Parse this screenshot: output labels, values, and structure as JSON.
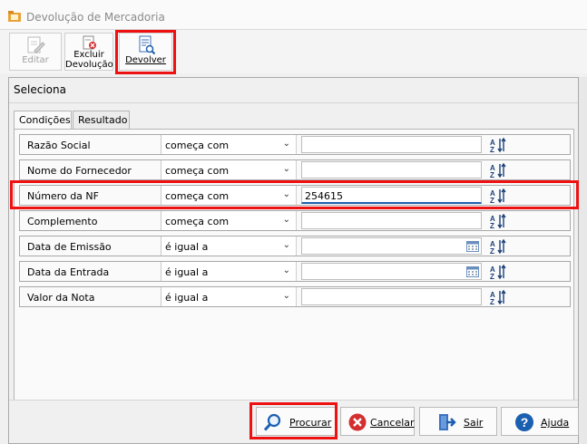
{
  "window": {
    "title": "Devolução de Mercadoria"
  },
  "toolbar": {
    "editar": "Editar",
    "excluir_line1": "Excluir",
    "excluir_line2": "Devolução",
    "devolver": "Devolver"
  },
  "dialog": {
    "title": "Seleciona",
    "tabs": [
      "Condições",
      "Resultado"
    ],
    "rows": [
      {
        "label": "Razão Social",
        "operator": "começa com",
        "value": ""
      },
      {
        "label": "Nome do Fornecedor",
        "operator": "começa com",
        "value": ""
      },
      {
        "label": "Número da NF",
        "operator": "começa com",
        "value": "254615"
      },
      {
        "label": "Complemento",
        "operator": "começa com",
        "value": ""
      },
      {
        "label": "Data de Emissão",
        "operator": "é igual a",
        "value": ""
      },
      {
        "label": "Data da Entrada",
        "operator": "é igual a",
        "value": ""
      },
      {
        "label": "Valor da Nota",
        "operator": "é igual a",
        "value": ""
      }
    ],
    "buttons": {
      "procurar": "Procurar",
      "cancelar": "Cancelar",
      "sair": "Sair",
      "ajuda": "Ajuda"
    }
  },
  "colors": {
    "highlight": "#ee1111",
    "accent": "#1b5fb0"
  },
  "icons": [
    "folder-icon",
    "edit-icon",
    "delete-icon",
    "return-document-icon",
    "search-icon",
    "cancel-icon",
    "exit-icon",
    "help-icon",
    "sort-icon",
    "calendar-icon",
    "chevron-down-icon"
  ]
}
